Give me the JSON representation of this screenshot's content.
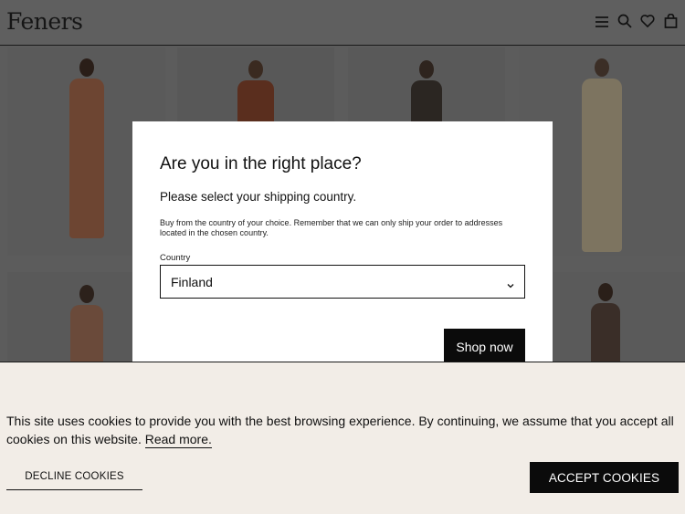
{
  "header": {
    "logo": "Feners",
    "icons": [
      "menu-icon",
      "search-icon",
      "heart-icon",
      "bag-icon"
    ]
  },
  "modal": {
    "title": "Are you in the right place?",
    "subtitle": "Please select your shipping country.",
    "note": "Buy from the country of your choice. Remember that we can only ship your order to addresses located in the chosen country.",
    "country_label": "Country",
    "country_value": "Finland",
    "submit_label": "Shop now"
  },
  "cookie_banner": {
    "text": "This site uses cookies to provide you with the best browsing experience. By continuing, we assume that you accept all cookies on this website.",
    "link_label": "Read more.",
    "decline_label": "DECLINE COOKIES",
    "accept_label": "ACCEPT COOKIES"
  },
  "colors": {
    "dim_background": "#5c5c5c",
    "cookie_background": "#f2ede7",
    "button_dark": "#0b0b0b"
  }
}
